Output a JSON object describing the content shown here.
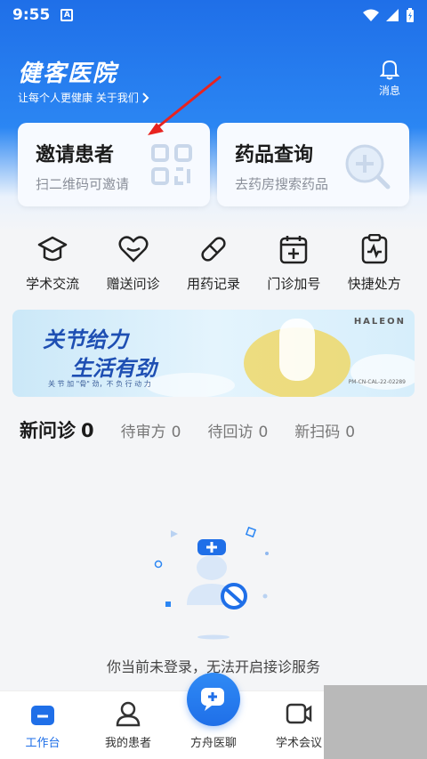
{
  "status_bar": {
    "time": "9:55",
    "sim_label": "A"
  },
  "header": {
    "app_name": "健客医院",
    "slogan": "让每个人更健康 关于我们",
    "message_label": "消息"
  },
  "cards": [
    {
      "title": "邀请患者",
      "subtitle": "扫二维码可邀请",
      "icon": "qr-code-icon"
    },
    {
      "title": "药品查询",
      "subtitle": "去药房搜索药品",
      "icon": "search-plus-icon"
    }
  ],
  "shortcuts": [
    {
      "label": "学术交流",
      "icon": "mortarboard-icon"
    },
    {
      "label": "赠送问诊",
      "icon": "heart-icon"
    },
    {
      "label": "用药记录",
      "icon": "pill-icon"
    },
    {
      "label": "门诊加号",
      "icon": "calendar-plus-icon"
    },
    {
      "label": "快捷处方",
      "icon": "clipboard-pulse-icon"
    }
  ],
  "banner": {
    "line1": "关节给力",
    "line2": "生活有劲",
    "line3": "关 节 加 \"骨\" 劲，不 负 行 动 力",
    "brand": "HALEON",
    "code": "PM-CN-CAL-22-02289"
  },
  "tabs": [
    {
      "label": "新问诊",
      "count": "0"
    },
    {
      "label": "待审方",
      "count": "0"
    },
    {
      "label": "待回访",
      "count": "0"
    },
    {
      "label": "新扫码",
      "count": "0"
    }
  ],
  "empty_state": {
    "message": "你当前未登录，无法开启接诊服务"
  },
  "bottom_nav": [
    {
      "label": "工作台",
      "icon": "workbench-icon"
    },
    {
      "label": "我的患者",
      "icon": "person-icon"
    },
    {
      "label": "方舟医聊",
      "icon": "chat-plus-icon"
    },
    {
      "label": "学术会议",
      "icon": "video-icon"
    }
  ],
  "colors": {
    "primary": "#1f6fe8",
    "text": "#1b1b1b",
    "muted": "#8a8f99"
  }
}
